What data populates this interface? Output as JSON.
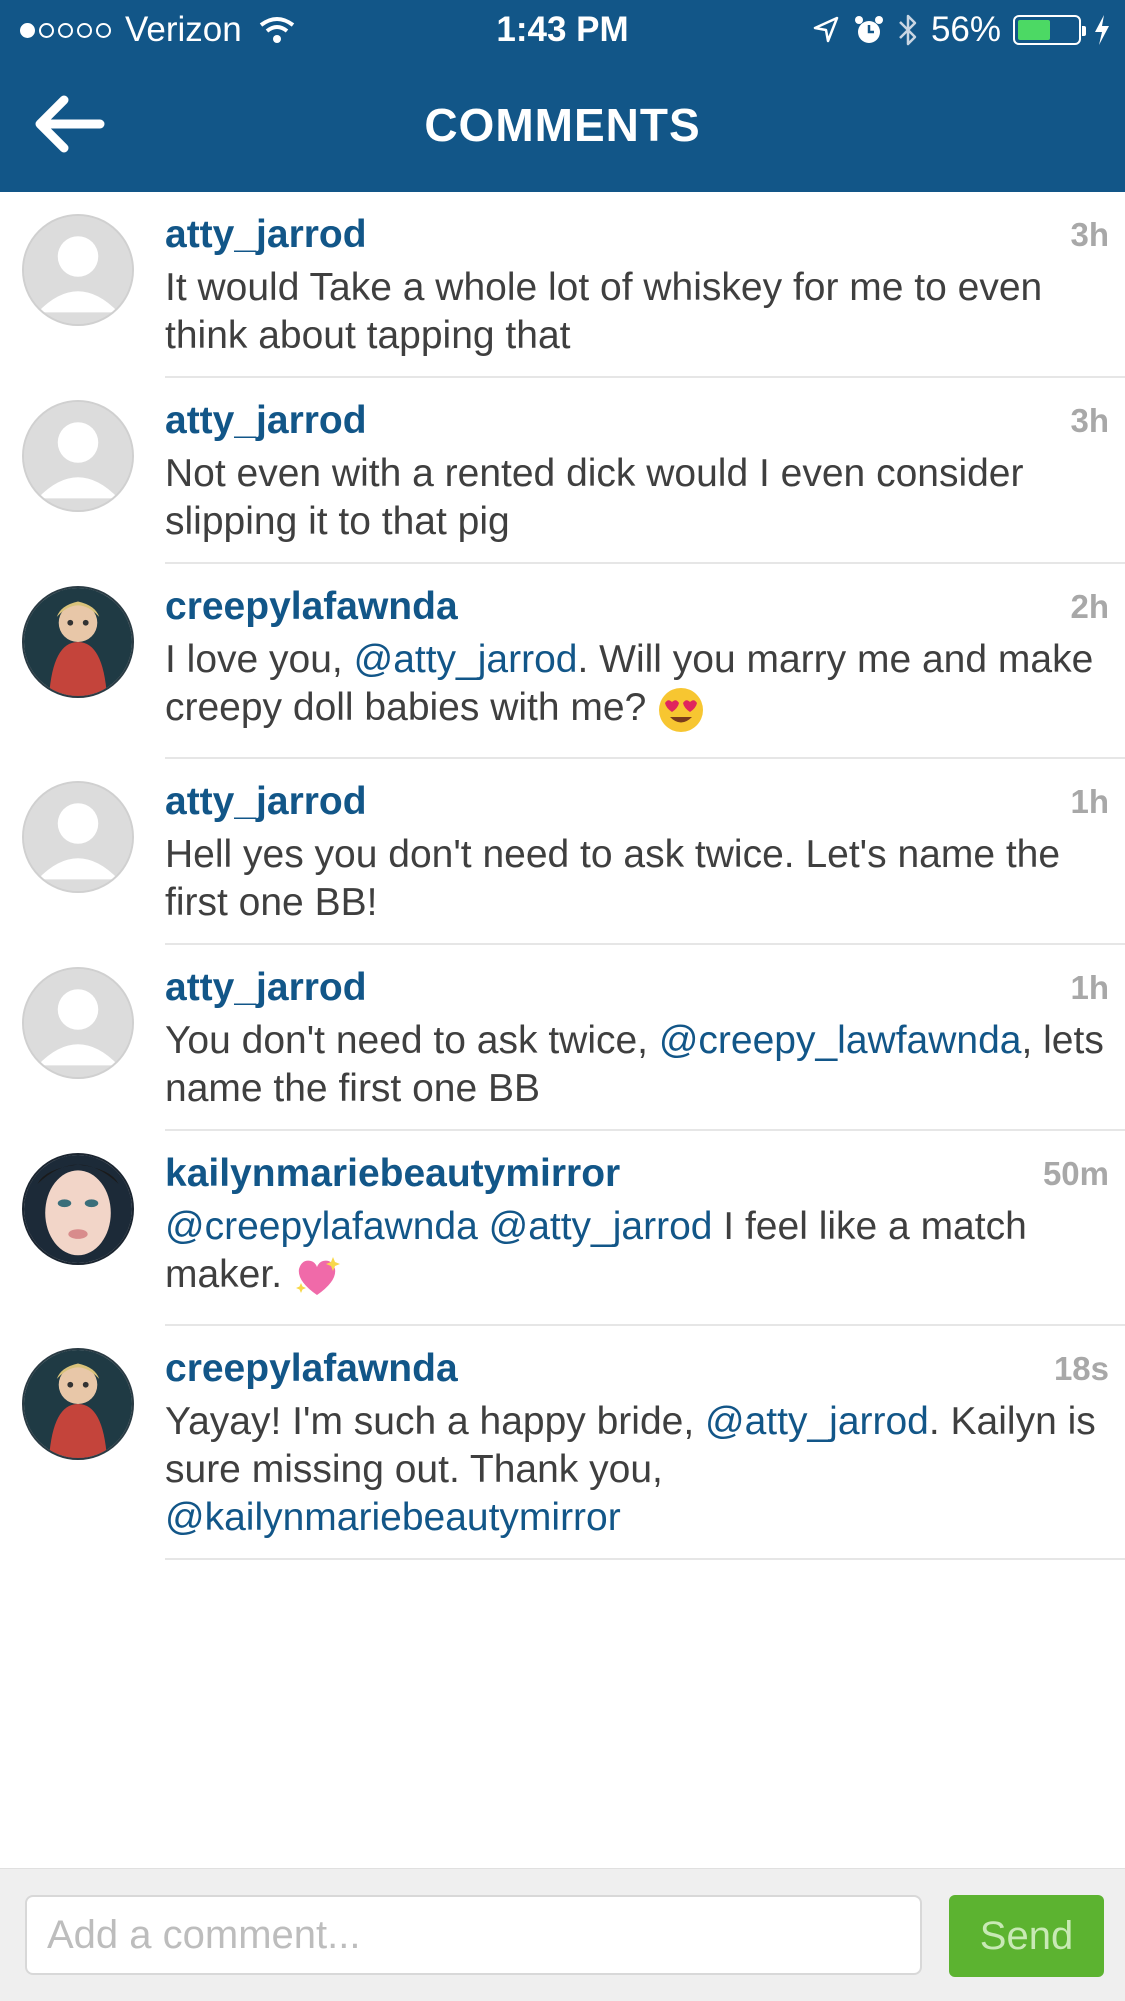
{
  "status_bar": {
    "carrier": "Verizon",
    "time": "1:43 PM",
    "battery": "56%",
    "battery_level": 0.56,
    "icons": [
      "signal-dots-icon",
      "wifi-icon",
      "location-arrow-icon",
      "alarm-icon",
      "bluetooth-icon",
      "battery-icon",
      "charging-bolt-icon"
    ]
  },
  "nav": {
    "title": "COMMENTS",
    "back_icon": "back-arrow-icon"
  },
  "colors": {
    "brand": "#125688",
    "link": "#125688",
    "send_button": "#5cb330"
  },
  "comments": [
    {
      "username": "atty_jarrod",
      "time": "3h",
      "avatar": "default-avatar",
      "text_parts": [
        "It would Take a whole lot of whiskey for me to even think about tapping that"
      ]
    },
    {
      "username": "atty_jarrod",
      "time": "3h",
      "avatar": "default-avatar",
      "text_parts": [
        "Not even with a rented dick would I even consider slipping it to that pig"
      ]
    },
    {
      "username": "creepylafawnda",
      "time": "2h",
      "avatar": "doll-photo-avatar",
      "text_parts": [
        "I love you, ",
        "@atty_jarrod",
        ".  Will you marry me and make creepy doll babies with me? "
      ],
      "emoji": "heart-eyes-emoji"
    },
    {
      "username": "atty_jarrod",
      "time": "1h",
      "avatar": "default-avatar",
      "text_parts": [
        "Hell yes you don't need to ask twice. Let's name the first one BB!"
      ]
    },
    {
      "username": "atty_jarrod",
      "time": "1h",
      "avatar": "default-avatar",
      "text_parts": [
        "You don't need to ask twice, ",
        "@creepy_lawfawnda",
        ", lets name the first one BB"
      ]
    },
    {
      "username": "kailynmariebeautymirror",
      "time": "50m",
      "avatar": "selfie-photo-avatar",
      "text_parts": [
        "@creepylafawnda",
        " ",
        "@atty_jarrod",
        " I feel like a match maker. "
      ],
      "emoji": "sparkling-heart-emoji"
    },
    {
      "username": "creepylafawnda",
      "time": "18s",
      "avatar": "doll-photo-avatar",
      "text_parts": [
        "Yayay!  I'm such a happy bride, ",
        "@atty_jarrod",
        ". Kailyn is sure missing out.  Thank you, ",
        "@kailynmariebeautymirror"
      ]
    }
  ],
  "composer": {
    "placeholder": "Add a comment...",
    "value": "",
    "send_label": "Send"
  }
}
